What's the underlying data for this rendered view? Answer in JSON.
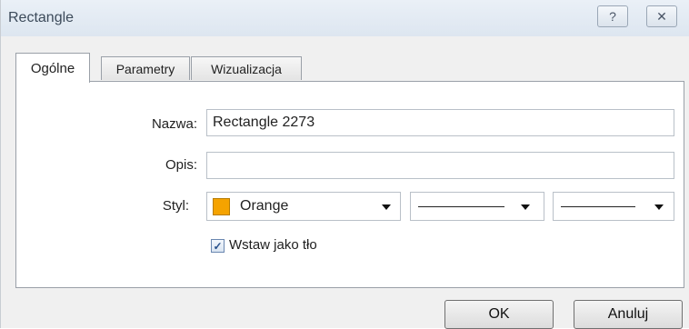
{
  "window": {
    "title": "Rectangle",
    "help_glyph": "?",
    "close_glyph": "✕"
  },
  "tabs": [
    {
      "label": "Ogólne",
      "active": true
    },
    {
      "label": "Parametry",
      "active": false
    },
    {
      "label": "Wizualizacja",
      "active": false
    }
  ],
  "form": {
    "name_label": "Nazwa:",
    "name_value": "Rectangle 2273",
    "desc_label": "Opis:",
    "desc_value": "",
    "style_label": "Styl:",
    "color_name": "Orange",
    "color_hex": "#f5a300",
    "background_checked": true,
    "background_label": "Wstaw jako tło"
  },
  "buttons": {
    "ok": "OK",
    "cancel": "Anuluj"
  }
}
